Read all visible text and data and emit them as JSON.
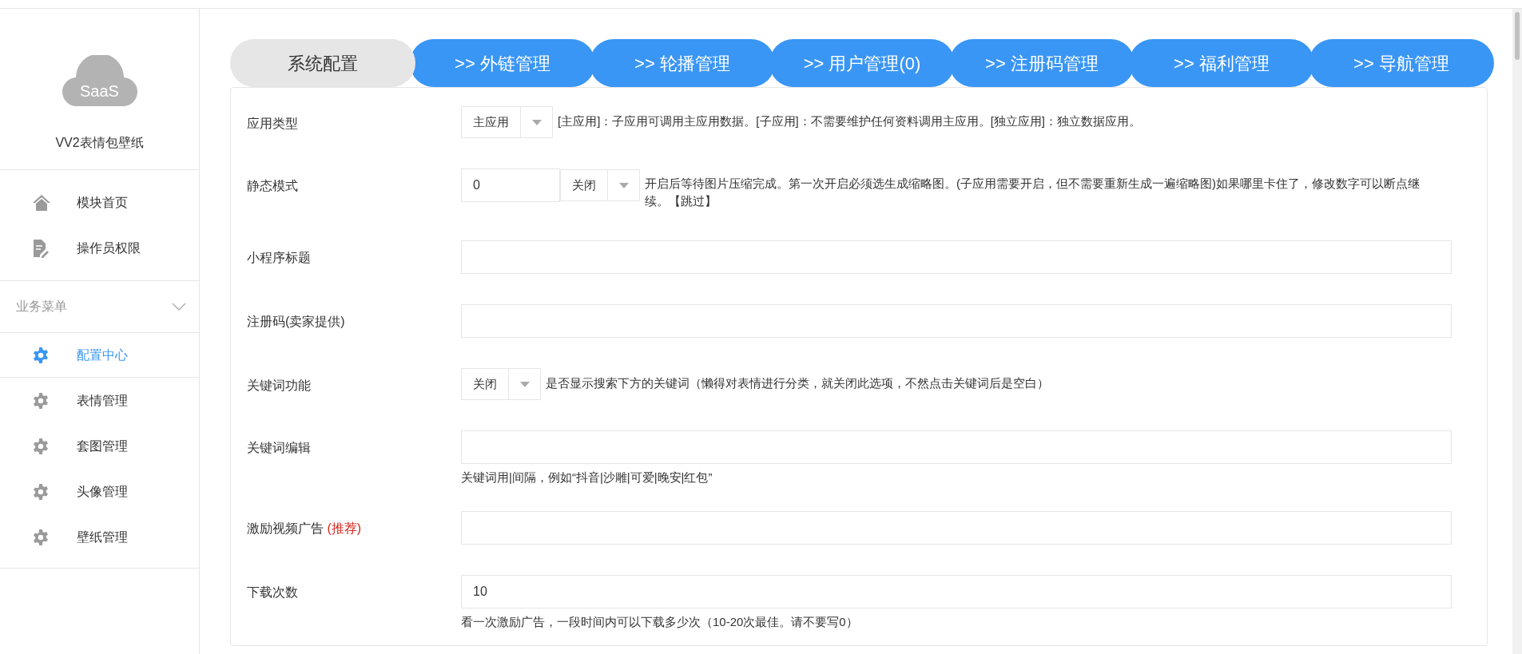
{
  "sidebar": {
    "logo_text": "SaaS",
    "app_name": "VV2表情包壁纸",
    "items": [
      {
        "label": "模块首页",
        "kind": "home",
        "selected": false
      },
      {
        "label": "操作员权限",
        "kind": "document",
        "selected": false
      }
    ],
    "section": {
      "title": "业务菜单",
      "expanded": true,
      "items": [
        {
          "label": "配置中心",
          "selected": true
        },
        {
          "label": "表情管理",
          "selected": false
        },
        {
          "label": "套图管理",
          "selected": false
        },
        {
          "label": "头像管理",
          "selected": false
        },
        {
          "label": "壁纸管理",
          "selected": false
        }
      ]
    }
  },
  "tabs": [
    {
      "label": "系统配置",
      "selected": true
    },
    {
      "label": ">> 外链管理",
      "selected": false
    },
    {
      "label": ">> 轮播管理",
      "selected": false
    },
    {
      "label": ">> 用户管理(0)",
      "selected": false
    },
    {
      "label": ">> 注册码管理",
      "selected": false
    },
    {
      "label": ">> 福利管理",
      "selected": false
    },
    {
      "label": ">> 导航管理",
      "selected": false
    }
  ],
  "fields": [
    {
      "kind": "select",
      "label": "应用类型",
      "select": "主应用",
      "description": "[主应用]：子应用可调用主应用数据。[子应用]：不需要维护任何资料调用主应用。[独立应用]：独立数据应用。"
    },
    {
      "kind": "number_select",
      "label": "静态模式",
      "value": "0",
      "select": "关闭",
      "description": "开启后等待图片压缩完成。第一次开启必须选生成缩略图。(子应用需要开启，但不需要重新生成一遍缩略图)如果哪里卡住了，修改数字可以断点继续。【跳过】"
    },
    {
      "kind": "text",
      "label": "小程序标题"
    },
    {
      "kind": "text",
      "label": "注册码(卖家提供)"
    },
    {
      "kind": "select",
      "label": "关键词功能",
      "select": "关闭",
      "description": "是否显示搜索下方的关键词（懒得对表情进行分类，就关闭此选项，不然点击关键词后是空白）"
    },
    {
      "kind": "text",
      "label": "关键词编辑",
      "hint": "关键词用|间隔，例如“抖音|沙雕|可爱|晚安|红包”"
    },
    {
      "kind": "text",
      "label": "激励视频广告",
      "label_note": "(推荐)"
    },
    {
      "kind": "text",
      "label": "下载次数",
      "value": "10",
      "hint": "看一次激励广告，一段时间内可以下载多少次（10-20次最佳。请不要写0）"
    }
  ]
}
